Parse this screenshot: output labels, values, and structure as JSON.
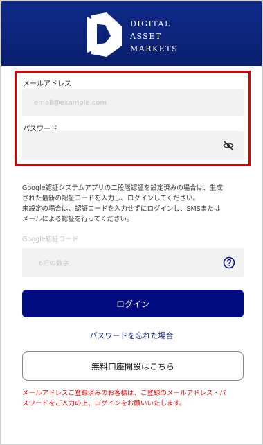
{
  "header": {
    "logo_lines": [
      "Digital",
      "Asset",
      "Markets"
    ],
    "logo_mark_icon": "dam-logo-icon",
    "background_color": "#0a1f6e"
  },
  "credentials": {
    "email_label": "メールアドレス",
    "email_placeholder": "email@example.com",
    "email_value": "",
    "password_label": "パスワード",
    "password_value": "",
    "password_toggle_icon": "eye-off-icon",
    "highlight_color": "#e00000"
  },
  "two_factor": {
    "notice_lines": [
      "Google認証システムアプリの二段階認証を設定済みの場合は、生成",
      "された最新の認証コードを入力し、ログインしてください。",
      "未設定の場合は、認証コードを入力せずにログインし、SMSまたは",
      "メールによる認証を行ってください。"
    ],
    "code_label": "Google認証コード",
    "code_placeholder": "6桁の数字",
    "code_value": "",
    "help_icon": "help-circle-icon"
  },
  "actions": {
    "login_label": "ログイン",
    "login_color": "#000c7f",
    "forgot_password_label": "パスワードを忘れた場合",
    "open_account_label": "無料口座開設はこちら"
  },
  "registered_note_lines": [
    "メールアドレスご登録済みのお客様は、ご登録のメールアドレス・パ",
    "スワードをご入力の上、ログインをお願いいたします。"
  ]
}
